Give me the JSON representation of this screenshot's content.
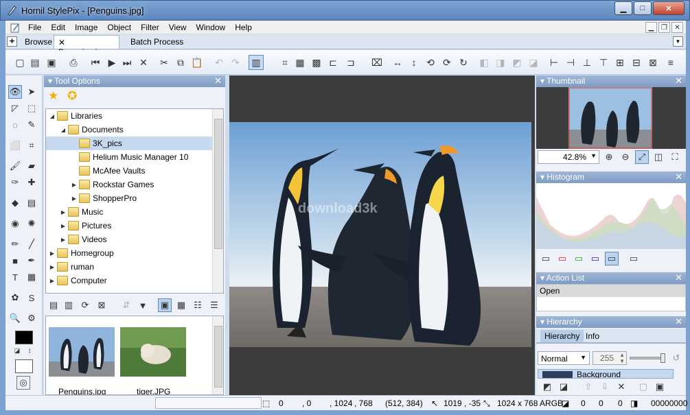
{
  "window": {
    "title": "Hornil StylePix - [Penguins.jpg]"
  },
  "menu": [
    "File",
    "Edit",
    "Image",
    "Object",
    "Filter",
    "View",
    "Window",
    "Help"
  ],
  "tabs": {
    "browse": "Browse",
    "active": "Penguins.jpg",
    "batch": "Batch Process"
  },
  "panels": {
    "tool_options": "Tool Options",
    "thumbnail": "Thumbnail",
    "histogram": "Histogram",
    "action_list": "Action List",
    "hierarchy": "Hierarchy"
  },
  "tree": [
    {
      "label": "Libraries",
      "level": 0,
      "expanded": true,
      "icon": "library-icon"
    },
    {
      "label": "Documents",
      "level": 1,
      "expanded": true,
      "icon": "documents-icon"
    },
    {
      "label": "3K_pics",
      "level": 2,
      "selected": true,
      "icon": "folder-icon"
    },
    {
      "label": "Helium Music Manager 10",
      "level": 2,
      "icon": "folder-icon"
    },
    {
      "label": "McAfee Vaults",
      "level": 2,
      "icon": "folder-icon"
    },
    {
      "label": "Rockstar Games",
      "level": 2,
      "collapsed": true,
      "icon": "folder-icon"
    },
    {
      "label": "ShopperPro",
      "level": 2,
      "collapsed": true,
      "icon": "folder-icon"
    },
    {
      "label": "Music",
      "level": 1,
      "collapsed": true,
      "icon": "music-icon"
    },
    {
      "label": "Pictures",
      "level": 1,
      "collapsed": true,
      "icon": "pictures-icon"
    },
    {
      "label": "Videos",
      "level": 1,
      "collapsed": true,
      "icon": "videos-icon"
    },
    {
      "label": "Homegroup",
      "level": 0,
      "collapsed": true,
      "icon": "homegroup-icon"
    },
    {
      "label": "ruman",
      "level": 0,
      "collapsed": true,
      "icon": "user-folder-icon"
    },
    {
      "label": "Computer",
      "level": 0,
      "collapsed": true,
      "icon": "computer-icon"
    }
  ],
  "thumbnails": [
    {
      "caption": "Penguins.jpg"
    },
    {
      "caption": "tiger.JPG"
    }
  ],
  "thumbnail_panel": {
    "zoom": "42.8%"
  },
  "action_list": {
    "items": [
      "Open"
    ]
  },
  "hierarchy": {
    "tabs": [
      "Hierarchy",
      "Info"
    ],
    "blend_mode": "Normal",
    "opacity": "255",
    "layer": "Background"
  },
  "status": {
    "coord1": "0",
    "coord2": ", 0",
    "coord3": ", 1024",
    "coord4": ", 768",
    "center": "(512, 384)",
    "cursor": "1019 , -35",
    "size": "1024 x 768 ARGB",
    "v1": "0",
    "v2": "0",
    "v3": "0",
    "v4": "00000000"
  },
  "watermark": "download3k",
  "colors": {
    "accent": "#7f9cc4",
    "selection": "#c7d9ef",
    "canvas_bg": "#3d3d3d"
  }
}
